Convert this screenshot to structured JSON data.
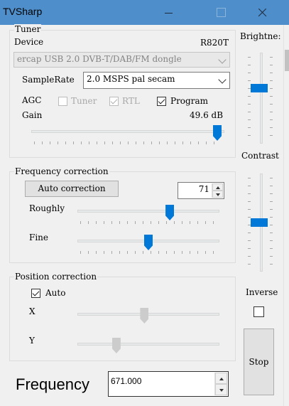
{
  "window": {
    "title": "TVSharp"
  },
  "tuner": {
    "legend": "Tuner",
    "device_label": "Device",
    "tuner_type": "R820T",
    "device_value": "ercap USB 2.0 DVB-T/DAB/FM dongle",
    "samplerate_label": "SampleRate",
    "samplerate_value": "2.0 MSPS pal secam",
    "agc_label": "AGC",
    "agc_tuner_label": "Tuner",
    "agc_tuner_checked": false,
    "agc_rtl_label": "RTL",
    "agc_rtl_checked": true,
    "agc_program_label": "Program",
    "agc_program_checked": true,
    "gain_label": "Gain",
    "gain_value": "49.6 dB",
    "gain_level": 1.0
  },
  "frequency_correction": {
    "legend": "Frequency correction",
    "auto_button": "Auto correction",
    "spin_value": "71",
    "roughly_label": "Roughly",
    "roughly_level": 0.66,
    "fine_label": "Fine",
    "fine_level": 0.5
  },
  "position_correction": {
    "legend": "Position correction",
    "auto_label": "Auto",
    "auto_checked": true,
    "x_label": "X",
    "x_level": 0.47,
    "y_label": "Y",
    "y_level": 0.26
  },
  "side": {
    "brightness_label": "Brightne:",
    "brightness_level": 0.62,
    "contrast_label": "Contrast",
    "contrast_level": 0.5,
    "inverse_label": "Inverse",
    "inverse_checked": false,
    "stop_button": "Stop"
  },
  "frequency": {
    "label": "Frequency",
    "value": "671.000"
  },
  "colors": {
    "titlebar": "#4e8fcb",
    "accent": "#0078d7"
  }
}
